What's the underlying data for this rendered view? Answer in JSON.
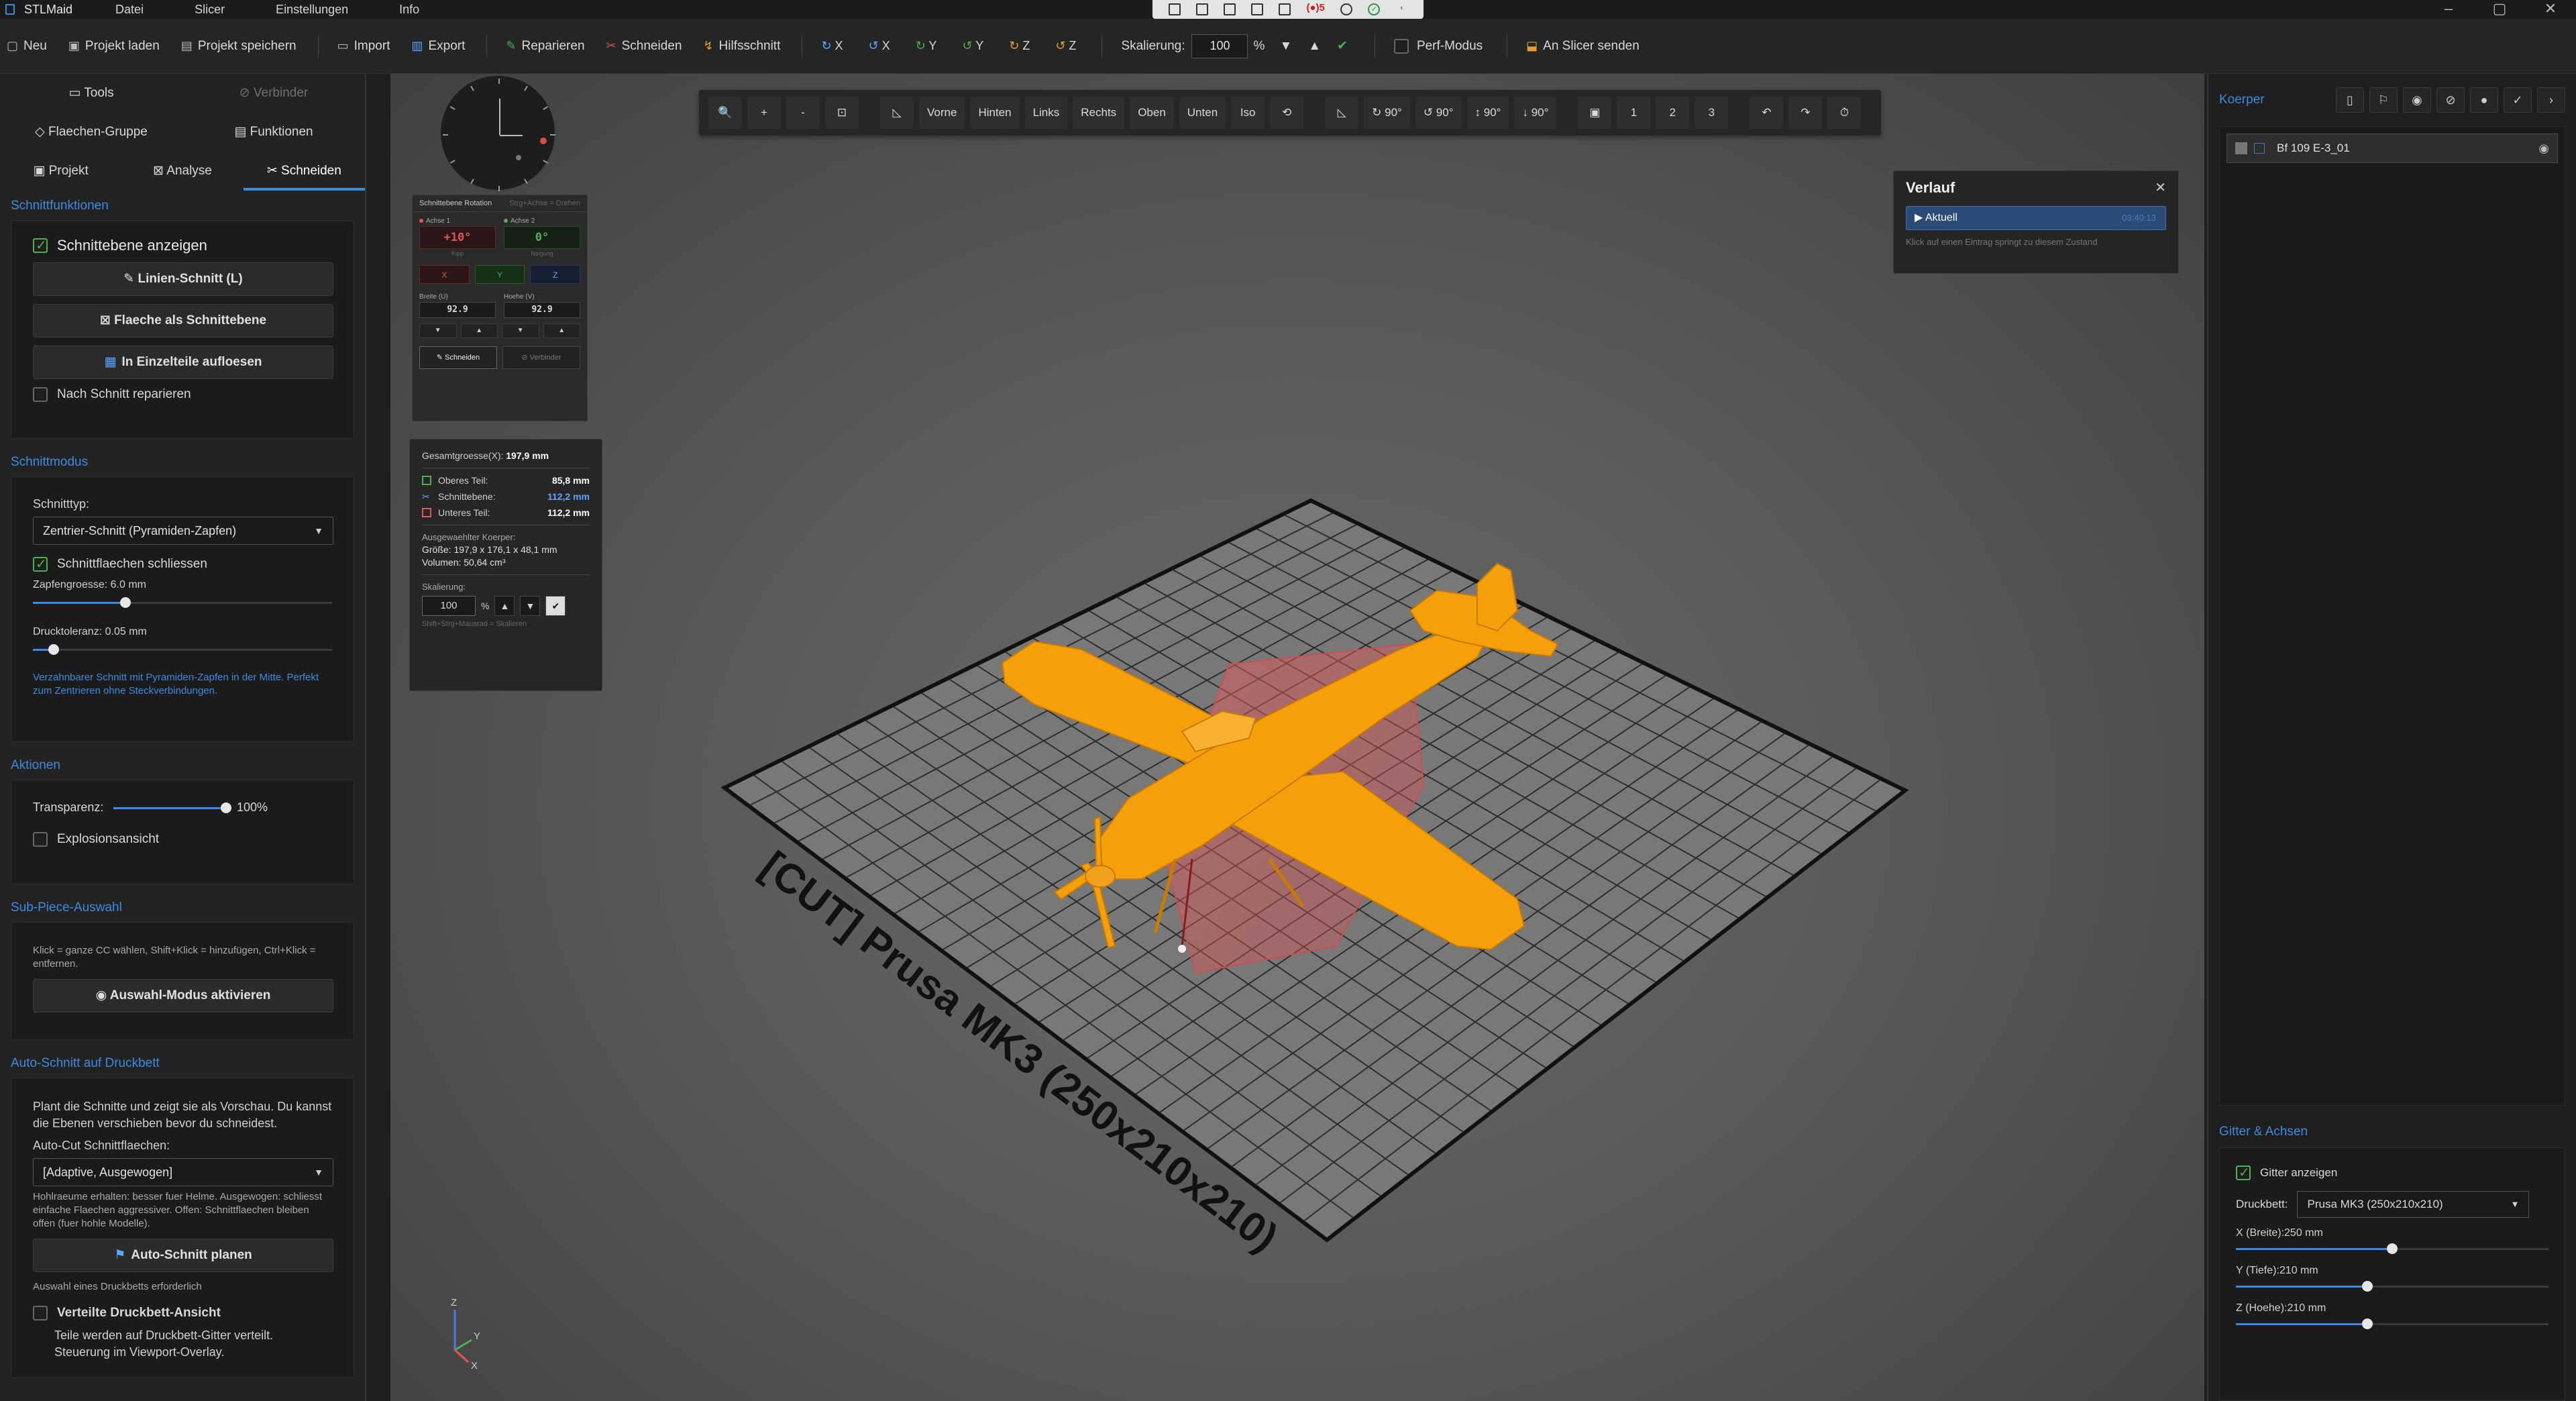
{
  "app": {
    "name": "STLMaid",
    "menu": [
      "Datei",
      "Slicer",
      "Einstellungen",
      "Info"
    ],
    "recording_count": "5"
  },
  "toolbar": {
    "new": "Neu",
    "load": "Projekt laden",
    "save": "Projekt speichern",
    "import": "Import",
    "export": "Export",
    "repair": "Reparieren",
    "cut": "Schneiden",
    "helpcut": "Hilfsschnitt",
    "rot_x1": "X",
    "rot_x2": "X",
    "rot_y1": "Y",
    "rot_y2": "Y",
    "rot_z1": "Z",
    "rot_z2": "Z",
    "scale_label": "Skalierung:",
    "scale_value": "100",
    "scale_unit": "%",
    "perf_mode": "Perf-Modus",
    "send_slicer": "An Slicer senden"
  },
  "left": {
    "tabs_row1": [
      "Tools",
      "Verbinder"
    ],
    "tabs_row2": [
      "Flaechen-Gruppe",
      "Funktionen"
    ],
    "tabs_row3": [
      "Projekt",
      "Analyse",
      "Schneiden"
    ],
    "sec_functions": "Schnittfunktionen",
    "show_plane": "Schnittebene anzeigen",
    "line_cut": "Linien-Schnitt (L)",
    "face_as_plane": "Flaeche als Schnittebene",
    "split_parts": "In Einzelteile aufloesen",
    "repair_after": "Nach Schnitt reparieren",
    "sec_mode": "Schnittmodus",
    "cut_type_label": "Schnitttyp:",
    "cut_type_value": "Zentrier-Schnitt (Pyramiden-Zapfen)",
    "close_surfaces": "Schnittflaechen schliessen",
    "peg_size": "Zapfengroesse: 6.0 mm",
    "peg_size_value": 0.31,
    "tolerance": "Drucktoleranz: 0.05 mm",
    "tolerance_value": 0.07,
    "mode_hint": "Verzahnbarer Schnitt mit Pyramiden-Zapfen in der Mitte. Perfekt zum Zentrieren ohne Steckverbindungen.",
    "sec_actions": "Aktionen",
    "transparency_label": "Transparenz:",
    "transparency_value": "100%",
    "explosion": "Explosionsansicht",
    "sec_subpiece": "Sub-Piece-Auswahl",
    "subpiece_hint": "Klick = ganze CC wählen, Shift+Klick = hinzufügen, Ctrl+Klick = entfernen.",
    "activate_selection": "Auswahl-Modus aktivieren",
    "sec_autocut": "Auto-Schnitt auf Druckbett",
    "autocut_desc": "Plant die Schnitte und zeigt sie als Vorschau. Du kannst die Ebenen verschieben bevor du schneidest.",
    "autocut_label": "Auto-Cut Schnittflaechen:",
    "autocut_value": "[Adaptive, Ausgewogen]",
    "autocut_note": "Hohlraeume erhalten: besser fuer Helme. Ausgewogen: schliesst einfache Flaechen aggressiver. Offen: Schnittflaechen bleiben offen (fuer hohle Modelle).",
    "plan_autocut": "Auto-Schnitt planen",
    "needs_bed": "Auswahl eines Druckbetts erforderlich",
    "distributed_view": "Verteilte Druckbett-Ansicht",
    "distributed_desc": "Teile werden auf Druckbett-Gitter verteilt. Steuerung im Viewport-Overlay."
  },
  "viewport": {
    "toolbar": {
      "zoom": "🔍",
      "plus": "+",
      "minus": "-",
      "fit": "⊡",
      "views": [
        "Vorne",
        "Hinten",
        "Links",
        "Rechts",
        "Oben",
        "Unten",
        "Iso"
      ],
      "reset": "⟲",
      "rotations": [
        "↻ 90°",
        "↺ 90°",
        "↕ 90°",
        "↓ 90°"
      ],
      "cams": [
        "1",
        "2",
        "3"
      ],
      "undo": "↶",
      "redo": "↷",
      "history": "⏱"
    },
    "rotation_panel": {
      "title": "Schnittebene Rotation",
      "subtitle": "Strg+Achse = Drehen",
      "axis1_label": "Achse 1",
      "axis2_label": "Achse 2",
      "axis1_value": "+10°",
      "axis2_value": "0°",
      "axis1_sub": "Kipp",
      "axis2_sub": "Neigung",
      "axes": [
        "X",
        "Y",
        "Z"
      ],
      "width_label": "Breite (U)",
      "height_label": "Hoehe (V)",
      "width_value": "92.9",
      "height_value": "92.9",
      "cut_btn": "Schneiden",
      "connector_btn": "Verbinder"
    },
    "info_panel": {
      "total_label": "Gesamtgroesse(X):",
      "total_value": "197,9 mm",
      "upper_label": "Oberes Teil:",
      "upper_value": "85,8 mm",
      "plane_label": "Schnittebene:",
      "plane_value": "112,2 mm",
      "lower_label": "Unteres Teil:",
      "lower_value": "112,2 mm",
      "selected_label": "Ausgewaehlter Koerper:",
      "size": "Größe: 197,9 x 176,1 x 48,1 mm",
      "volume": "Volumen: 50,64 cm³",
      "scale_label": "Skalierung:",
      "scale_value": "100",
      "scale_unit": "%",
      "footer": "Shift+Strg+Mausrad = Skalieren"
    },
    "history": {
      "title": "Verlauf",
      "current": "Aktuell",
      "time": "03:40:13",
      "hint": "Klick auf einen Eintrag springt zu diesem Zustand"
    },
    "bed_label": "[CUT] Prusa MK3 (250x210x210)",
    "gizmo": {
      "z": "Z",
      "y": "Y",
      "x": "X"
    }
  },
  "right": {
    "title": "Koerper",
    "body_name": "Bf 109 E-3_01",
    "sec_grid": "Gitter & Achsen",
    "show_grid": "Gitter anzeigen",
    "bed_label": "Druckbett:",
    "bed_value": "Prusa MK3 (250x210x210)",
    "x_label": "X (Breite):250 mm",
    "y_label": "Y (Tiefe):210 mm",
    "z_label": "Z (Hoehe):210 mm",
    "x_value": 250,
    "y_value": 210,
    "z_value": 210
  },
  "colors": {
    "accent": "#3d8be0",
    "model": "#f5a00a",
    "cut_plane": "#e05555"
  }
}
